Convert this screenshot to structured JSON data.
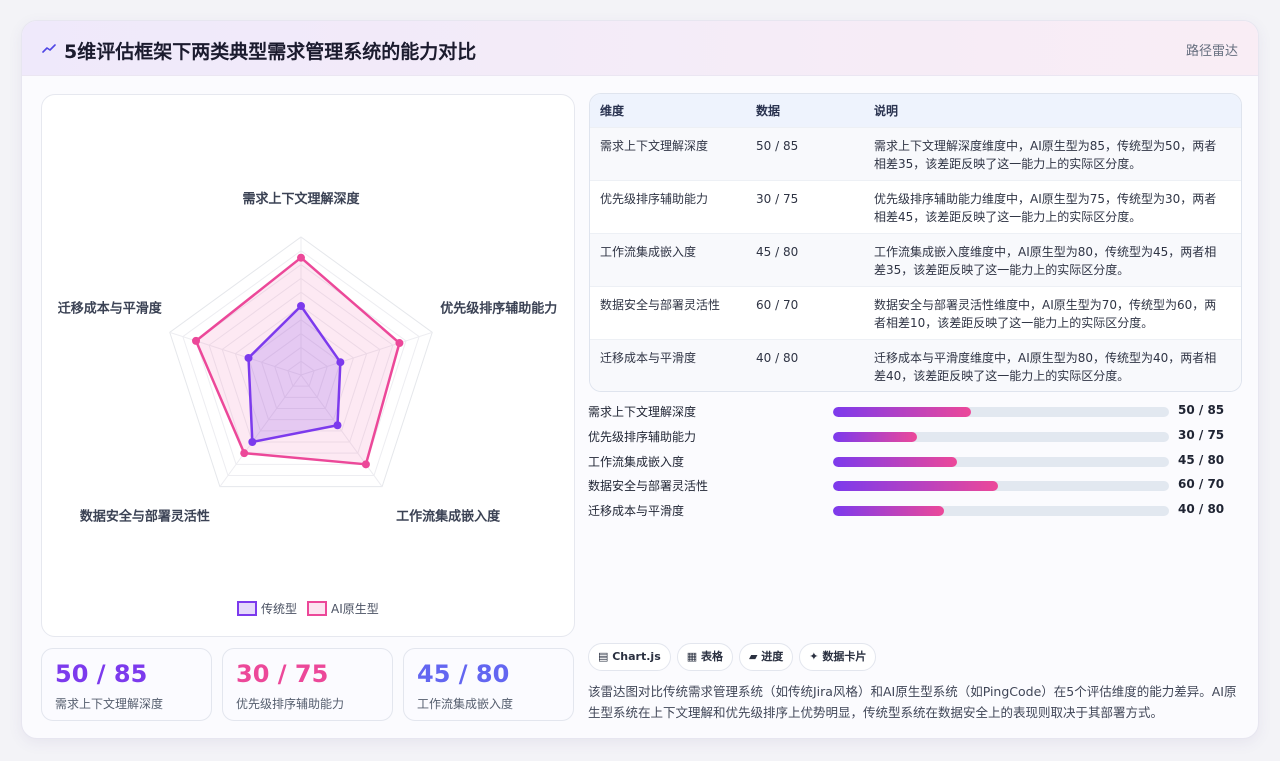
{
  "header": {
    "icon": "trend-icon",
    "title": "5维评估框架下两类典型需求管理系统的能力对比",
    "right_label": "路径雷达"
  },
  "colors": {
    "traditional": "#7c3aed",
    "ai_native": "#ec4899",
    "kpi_1": "#7c3aed",
    "kpi_2": "#ec4899",
    "kpi_3": "#6366f1"
  },
  "chart_data": {
    "type": "radar",
    "axes": [
      "需求上下文理解深度",
      "优先级排序辅助能力",
      "工作流集成嵌入度",
      "数据安全与部署灵活性",
      "迁移成本与平滑度"
    ],
    "rlim": [
      0,
      100
    ],
    "grid": true,
    "legend_position": "bottom-center",
    "series": [
      {
        "name": "传统型",
        "values": [
          50,
          30,
          45,
          60,
          40
        ]
      },
      {
        "name": "AI原生型",
        "values": [
          85,
          75,
          80,
          70,
          80
        ]
      }
    ]
  },
  "table": {
    "headers": [
      "维度",
      "数据",
      "说明"
    ],
    "rows": [
      {
        "dim": "需求上下文理解深度",
        "data": "50 / 85",
        "desc": "需求上下文理解深度维度中，AI原生型为85，传统型为50，两者相差35，该差距反映了这一能力上的实际区分度。"
      },
      {
        "dim": "优先级排序辅助能力",
        "data": "30 / 75",
        "desc": "优先级排序辅助能力维度中，AI原生型为75，传统型为30，两者相差45，该差距反映了这一能力上的实际区分度。"
      },
      {
        "dim": "工作流集成嵌入度",
        "data": "45 / 80",
        "desc": "工作流集成嵌入度维度中，AI原生型为80，传统型为45，两者相差35，该差距反映了这一能力上的实际区分度。"
      },
      {
        "dim": "数据安全与部署灵活性",
        "data": "60 / 70",
        "desc": "数据安全与部署灵活性维度中，AI原生型为70，传统型为60，两者相差10，该差距反映了这一能力上的实际区分度。"
      },
      {
        "dim": "迁移成本与平滑度",
        "data": "40 / 80",
        "desc": "迁移成本与平滑度维度中，AI原生型为80，传统型为40，两者相差40，该差距反映了这一能力上的实际区分度。"
      }
    ]
  },
  "progress": [
    {
      "label": "需求上下文理解深度",
      "value": "50 / 85",
      "fraction": 0.41
    },
    {
      "label": "优先级排序辅助能力",
      "value": "30 / 75",
      "fraction": 0.25
    },
    {
      "label": "工作流集成嵌入度",
      "value": "45 / 80",
      "fraction": 0.37
    },
    {
      "label": "数据安全与部署灵活性",
      "value": "60 / 70",
      "fraction": 0.49
    },
    {
      "label": "迁移成本与平滑度",
      "value": "40 / 80",
      "fraction": 0.33
    }
  ],
  "kpis": [
    {
      "value": "50 / 85",
      "label": "需求上下文理解深度"
    },
    {
      "value": "30 / 75",
      "label": "优先级排序辅助能力"
    },
    {
      "value": "45 / 80",
      "label": "工作流集成嵌入度"
    }
  ],
  "tags": [
    {
      "icon": "chart-icon",
      "label": "Chart.js"
    },
    {
      "icon": "table-icon",
      "label": "表格"
    },
    {
      "icon": "progress-icon",
      "label": "进度"
    },
    {
      "icon": "sparkle-icon",
      "label": "数据卡片"
    }
  ],
  "summary": "该雷达图对比传统需求管理系统（如传统Jira风格）和AI原生型系统（如PingCode）在5个评估维度的能力差异。AI原生型系统在上下文理解和优先级排序上优势明显，传统型系统在数据安全上的表现则取决于其部署方式。"
}
